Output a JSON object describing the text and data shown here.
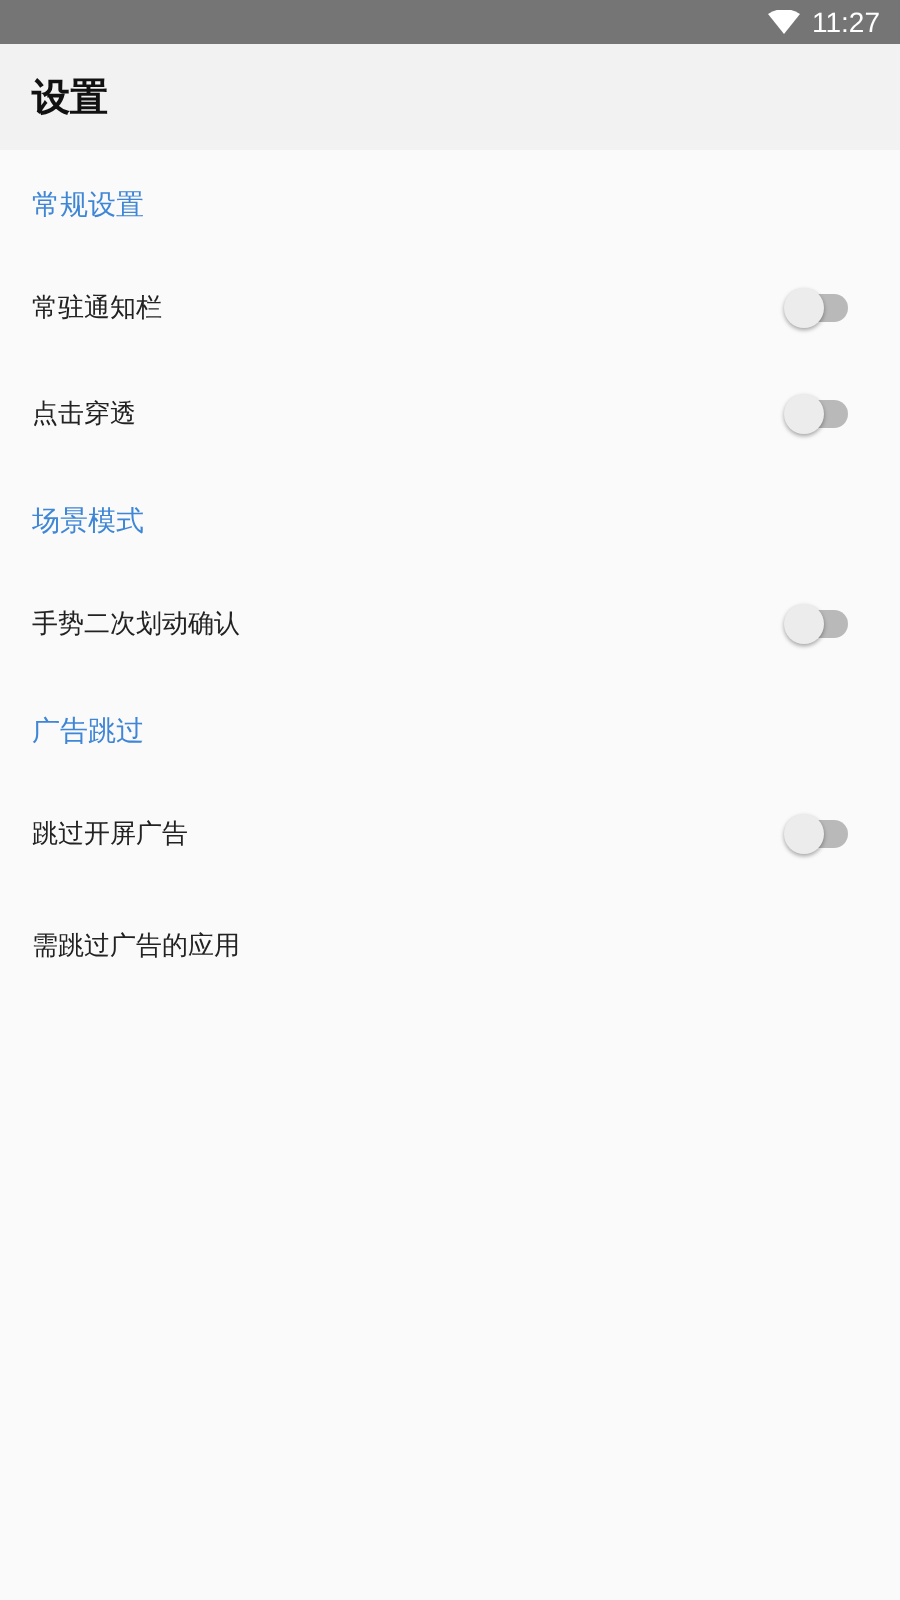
{
  "status_bar": {
    "time": "11:27"
  },
  "app_bar": {
    "title": "设置"
  },
  "sections": [
    {
      "title": "常规设置",
      "items": [
        {
          "kind": "switch",
          "label": "常驻通知栏",
          "on": false
        },
        {
          "kind": "switch",
          "label": "点击穿透",
          "on": false
        }
      ]
    },
    {
      "title": "场景模式",
      "items": [
        {
          "kind": "switch",
          "label": "手势二次划动确认",
          "on": false
        }
      ]
    },
    {
      "title": "广告跳过",
      "items": [
        {
          "kind": "switch",
          "label": "跳过开屏广告",
          "on": false
        },
        {
          "kind": "link",
          "label": "需跳过广告的应用"
        }
      ]
    }
  ]
}
